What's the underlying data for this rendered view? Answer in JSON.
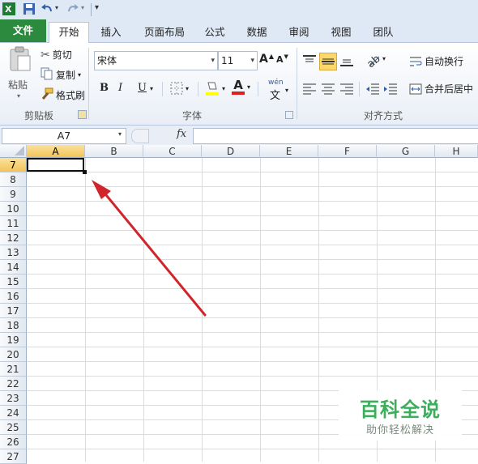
{
  "quick_access": {
    "icons": [
      "excel-logo-icon",
      "save-icon",
      "undo-icon",
      "redo-icon",
      "customize-qat-icon"
    ]
  },
  "tabs": [
    {
      "label": "文件"
    },
    {
      "label": "开始"
    },
    {
      "label": "插入"
    },
    {
      "label": "页面布局"
    },
    {
      "label": "公式"
    },
    {
      "label": "数据"
    },
    {
      "label": "审阅"
    },
    {
      "label": "视图"
    },
    {
      "label": "团队"
    }
  ],
  "ribbon": {
    "clipboard": {
      "paste_label": "粘贴",
      "cut_label": "剪切",
      "copy_label": "复制",
      "format_painter_label": "格式刷",
      "group_label": "剪贴板"
    },
    "font": {
      "font_name": "宋体",
      "font_size": "11",
      "bold": "B",
      "italic": "I",
      "underline": "U",
      "grow_font": "A",
      "shrink_font": "A",
      "font_color_glyph": "A",
      "phonetic_glyph": "wén",
      "phonetic_char": "文",
      "group_label": "字体"
    },
    "alignment": {
      "wrap_text_label": "自动换行",
      "merge_center_label": "合并后居中",
      "group_label": "对齐方式"
    }
  },
  "formula_bar": {
    "name_box": "A7",
    "fx": "fx",
    "formula": ""
  },
  "sheet": {
    "columns": [
      "A",
      "B",
      "C",
      "D",
      "E",
      "F",
      "G",
      "H"
    ],
    "rows": [
      "7",
      "8",
      "9",
      "10",
      "11",
      "12",
      "13",
      "14",
      "15",
      "16",
      "17",
      "18",
      "19",
      "20",
      "21",
      "22",
      "23",
      "24",
      "25",
      "26",
      "27"
    ],
    "selected_cell": "A7"
  },
  "watermark": {
    "title": "百科全说",
    "subtitle": "助你轻松解决"
  },
  "colors": {
    "file_tab": "#2c8a3e",
    "arrow": "#d0252a",
    "selection_header": "#f2c45a",
    "watermark": "#3cae5b"
  }
}
